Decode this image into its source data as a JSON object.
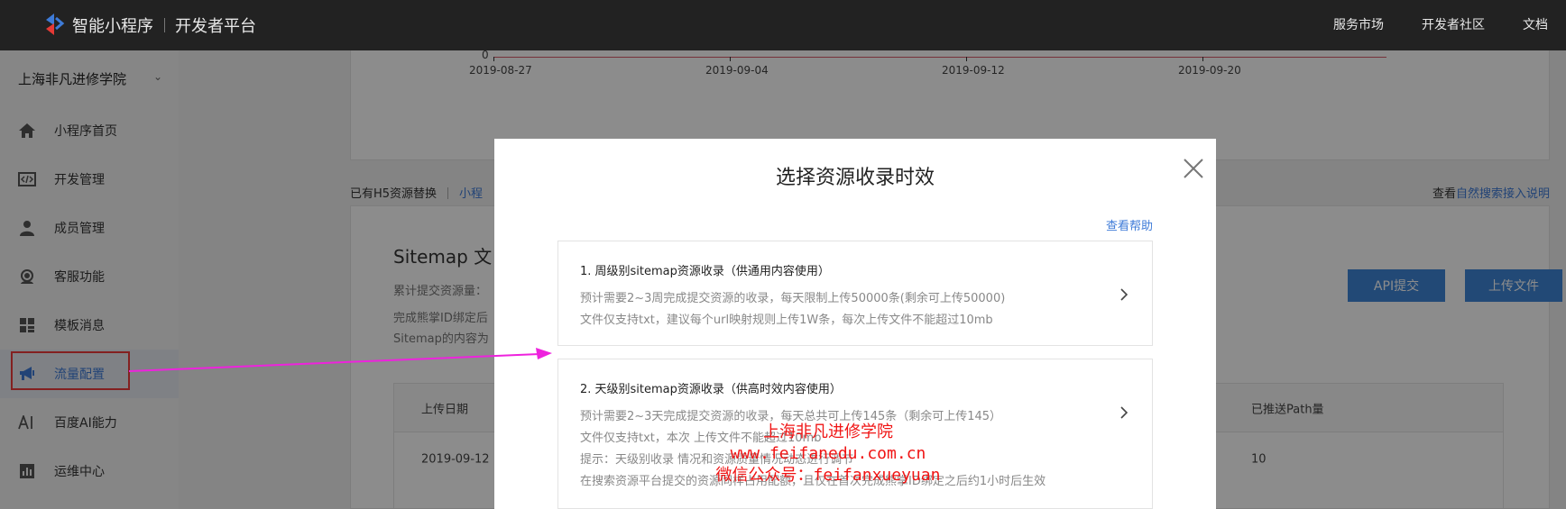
{
  "topbar": {
    "logo_text": "智能小程序",
    "platform_text": "开发者平台",
    "nav": [
      "服务市场",
      "开发者社区",
      "文档"
    ]
  },
  "sidebar": {
    "account_name": "上海非凡进修学院",
    "items": [
      {
        "label": "小程序首页",
        "icon": "home-icon"
      },
      {
        "label": "开发管理",
        "icon": "code-icon"
      },
      {
        "label": "成员管理",
        "icon": "user-icon"
      },
      {
        "label": "客服功能",
        "icon": "headset-icon"
      },
      {
        "label": "模板消息",
        "icon": "grid-icon"
      },
      {
        "label": "流量配置",
        "icon": "megaphone-icon",
        "active": true
      },
      {
        "label": "百度AI能力",
        "icon": "ai-icon"
      },
      {
        "label": "运维中心",
        "icon": "bar-chart-icon"
      }
    ]
  },
  "chart_area": {
    "zero_label": "0",
    "x_ticks": [
      "2019-08-27",
      "2019-09-04",
      "2019-09-12",
      "2019-09-20"
    ]
  },
  "h5_row": {
    "text": "已有H5资源替换",
    "link": "小程"
  },
  "help_right": {
    "prefix": "查看",
    "link": "自然搜索接入说明"
  },
  "sitemap": {
    "title": "Sitemap 文",
    "line1": "累计提交资源量：",
    "line2": "完成熊掌ID绑定后",
    "line3": "Sitemap的内容为",
    "api_button": "API提交",
    "upload_button": "上传文件",
    "table": {
      "col_date": "上传日期",
      "col_path": "已推送Path量",
      "row_date": "2019-09-12",
      "row_path": "10"
    }
  },
  "modal": {
    "title": "选择资源收录时效",
    "help_link": "查看帮助",
    "options": [
      {
        "title": "1. 周级别sitemap资源收录（供通用内容使用）",
        "lines": [
          "预计需要2~3周完成提交资源的收录，每天限制上传50000条(剩余可上传50000)",
          "文件仅支持txt，建议每个url映射规则上传1W条，每次上传文件不能超过10mb"
        ]
      },
      {
        "title": "2. 天级别sitemap资源收录（供高时效内容使用）",
        "lines": [
          "预计需要2~3天完成提交资源的收录，每天总共可上传145条（剩余可上传145）",
          "文件仅支持txt，本次                                 上传文件不能超过10mb",
          "提示：天级别收录                                        情况和资源质量情况动态进行调节",
          "在搜索资源平台提交的资源同样占用配额，且仅在首次完成熊掌ID绑定之后约1小时后生效"
        ]
      }
    ]
  },
  "watermark": {
    "line1": "上海非凡进修学院",
    "line2": "www.feifanedu.com.cn",
    "line3": "微信公众号：feifanxueyuan"
  },
  "colors": {
    "accent": "#3e7bd8",
    "button": "#3e86d8",
    "annotation_box": "#ee3b3b",
    "annotation_arrow": "#ee22dd",
    "watermark": "#f01414"
  }
}
